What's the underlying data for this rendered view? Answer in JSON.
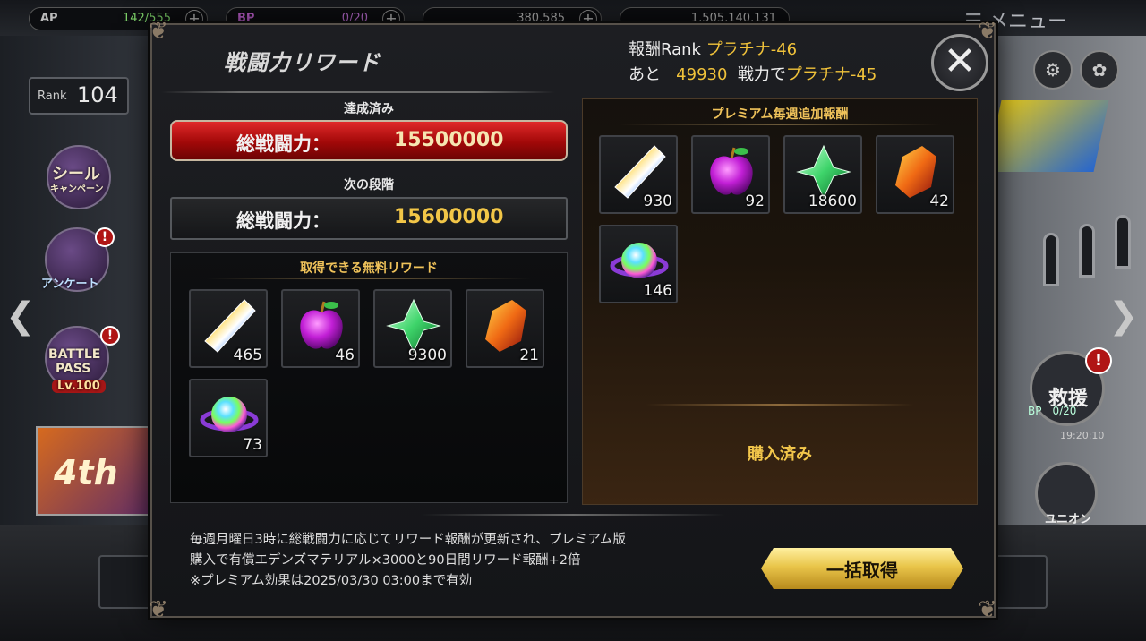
{
  "topbar": {
    "ap_label": "AP",
    "ap_value": "142/555",
    "bp_label": "BP",
    "bp_value": "0/20",
    "currency1_value": "380,585",
    "currency2_value": "1,505,140,131",
    "menu_label": "メニュー"
  },
  "left_ui": {
    "rank_label": "Rank",
    "rank_value": "104",
    "seal_campaign_l1": "シール",
    "seal_campaign_l2": "キャンペーン",
    "survey_label": "アンケート",
    "battle_pass_l1": "BATTLE",
    "battle_pass_l2": "PASS",
    "battle_pass_level": "Lv.100",
    "banner_text": "4th",
    "notify_mark": "!"
  },
  "right_ui": {
    "rescue_label": "救援",
    "bp_status": "BP　0/20",
    "time": "19:20:10",
    "union_label": "ユニオン",
    "notify_mark": "!"
  },
  "modal": {
    "title": "戦闘力リワード",
    "reward_rank_label": "報酬Rank",
    "reward_rank_value": "プラチナ-46",
    "next_prefix": "あと",
    "next_amount": "49930",
    "next_middle": "戦力で",
    "next_rank": "プラチナ-45",
    "close_symbol": "✕",
    "achieved_label": "達成済み",
    "next_stage_label": "次の段階",
    "power_label": "総戦闘力：",
    "achieved_value": "15500000",
    "next_value": "15600000",
    "free_rewards_title": "取得できる無料リワード",
    "free_rewards": [
      {
        "icon": "rainbow-crystal-icon",
        "qty": "465"
      },
      {
        "icon": "purple-apple-icon",
        "qty": "46"
      },
      {
        "icon": "green-gem-icon",
        "qty": "9300"
      },
      {
        "icon": "orange-stone-icon",
        "qty": "21"
      },
      {
        "icon": "rainbow-orb-icon",
        "qty": "73"
      }
    ],
    "premium_title": "プレミアム毎週追加報酬",
    "premium_rewards": [
      {
        "icon": "rainbow-crystal-icon",
        "qty": "930"
      },
      {
        "icon": "purple-apple-icon",
        "qty": "92"
      },
      {
        "icon": "green-gem-icon",
        "qty": "18600"
      },
      {
        "icon": "orange-stone-icon",
        "qty": "42"
      },
      {
        "icon": "rainbow-orb-icon",
        "qty": "146"
      }
    ],
    "purchased_label": "購入済み",
    "note_line1": "毎週月曜日3時に総戦闘力に応じてリワード報酬が更新され、プレミアム版",
    "note_line2": "購入で有償エデンズマテリアル×3000と90日間リワード報酬+2倍",
    "note_line3": "※プレミアム効果は2025/03/30 03:00まで有効",
    "bulk_button_label": "一括取得"
  },
  "colors": {
    "accent_gold": "#f0c23a",
    "achieved_red": "#c41414",
    "button_gold": "#e9c54a"
  }
}
